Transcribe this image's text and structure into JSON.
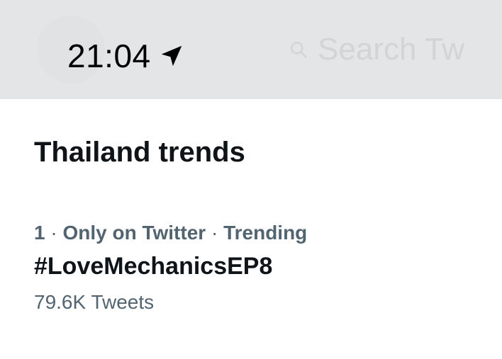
{
  "status_bar": {
    "time": "21:04",
    "location_icon": "location-arrow-icon"
  },
  "background": {
    "search_placeholder": "Search Tw",
    "search_icon": "search-icon"
  },
  "section": {
    "title": "Thailand trends"
  },
  "trends": [
    {
      "rank": "1",
      "context": "Only on Twitter",
      "status": "Trending",
      "name": "#LoveMechanicsEP8",
      "count": "79.6K Tweets"
    }
  ],
  "colors": {
    "status_bar_bg": "#e4e5e6",
    "primary_text": "#0f1419",
    "secondary_text": "#536471"
  }
}
